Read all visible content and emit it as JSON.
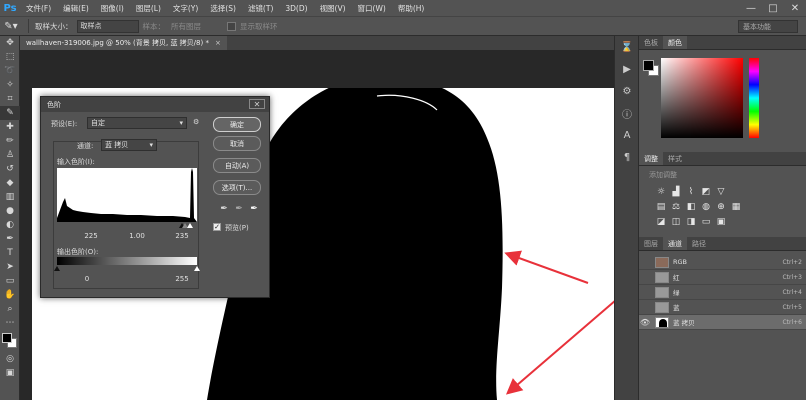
{
  "app": {
    "logo": "Ps"
  },
  "menu": [
    "文件(F)",
    "编辑(E)",
    "图像(I)",
    "图层(L)",
    "文字(Y)",
    "选择(S)",
    "滤镜(T)",
    "3D(D)",
    "视图(V)",
    "窗口(W)",
    "帮助(H)"
  ],
  "window_controls": {
    "minimize": "—",
    "maximize": "□",
    "close": "✕"
  },
  "options_bar": {
    "sample_size_label": "取样大小：",
    "sample_size_value": "取样点",
    "tolerance_label": "样本：",
    "tolerance_value": "所有图层",
    "sample_all_label": "显示取样环",
    "workspace_value": "基本功能"
  },
  "document_tab": {
    "title": "wallhaven-319006.jpg @ 50% (背景 拷贝, 蓝 拷贝/8) *",
    "close": "×"
  },
  "levels_dialog": {
    "title": "色阶",
    "preset_label": "预设(E):",
    "preset_value": "自定",
    "channel_label": "通道:",
    "channel_value": "蓝 拷贝",
    "input_label": "输入色阶(I):",
    "input_values": [
      "225",
      "1.00",
      "235"
    ],
    "output_label": "输出色阶(O):",
    "output_values": [
      "0",
      "255"
    ],
    "buttons": {
      "ok": "确定",
      "cancel": "取消",
      "auto": "自动(A)",
      "options": "选项(T)..."
    },
    "preview_label": "预览(P)",
    "preview_checked": true
  },
  "panels": {
    "color_tabs": [
      "色板",
      "颜色"
    ],
    "adjust_tabs": [
      "调整",
      "样式"
    ],
    "adjust_title": "添加调整",
    "channel_tabs": [
      "图层",
      "通道",
      "路径"
    ],
    "channels": [
      {
        "name": "RGB",
        "shortcut": "Ctrl+2",
        "visible": false
      },
      {
        "name": "红",
        "shortcut": "Ctrl+3",
        "visible": false
      },
      {
        "name": "绿",
        "shortcut": "Ctrl+4",
        "visible": false
      },
      {
        "name": "蓝",
        "shortcut": "Ctrl+5",
        "visible": false
      },
      {
        "name": "蓝 拷贝",
        "shortcut": "Ctrl+6",
        "visible": true
      }
    ]
  },
  "colors": {
    "arrow": "#e8313a",
    "panel_bg": "#535353",
    "canvas_bg": "#282828"
  }
}
